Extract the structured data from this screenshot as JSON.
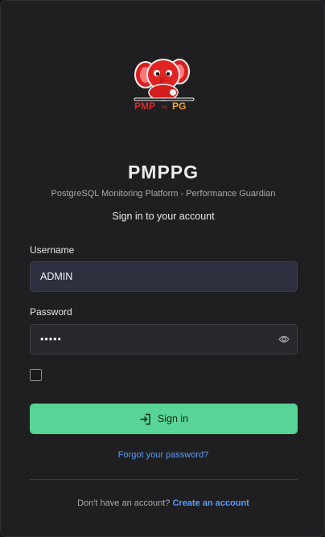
{
  "brand": {
    "title": "PMPPG",
    "subtitle": "PostgreSQL Monitoring Platform - Performance Guardian",
    "logo": {
      "icon": "red-elephant-mascot-logo",
      "wordmark": "PMP for PG"
    }
  },
  "form": {
    "heading": "Sign in to your account",
    "username": {
      "label": "Username",
      "value": "ADMIN"
    },
    "password": {
      "label": "Password",
      "value": "•••••",
      "toggle_icon": "eye-icon"
    },
    "remember": {
      "checked": false
    },
    "submit_label": "Sign in",
    "submit_icon": "login-arrow-icon",
    "forgot_label": "Forgot your password?"
  },
  "footer": {
    "prompt": "Don't have an account?",
    "create_label": "Create an account"
  },
  "colors": {
    "background": "#1f1f22",
    "accent": "#57d496",
    "link": "#5b9cf7",
    "username_field": "#2e3040",
    "password_field": "#28282c"
  }
}
